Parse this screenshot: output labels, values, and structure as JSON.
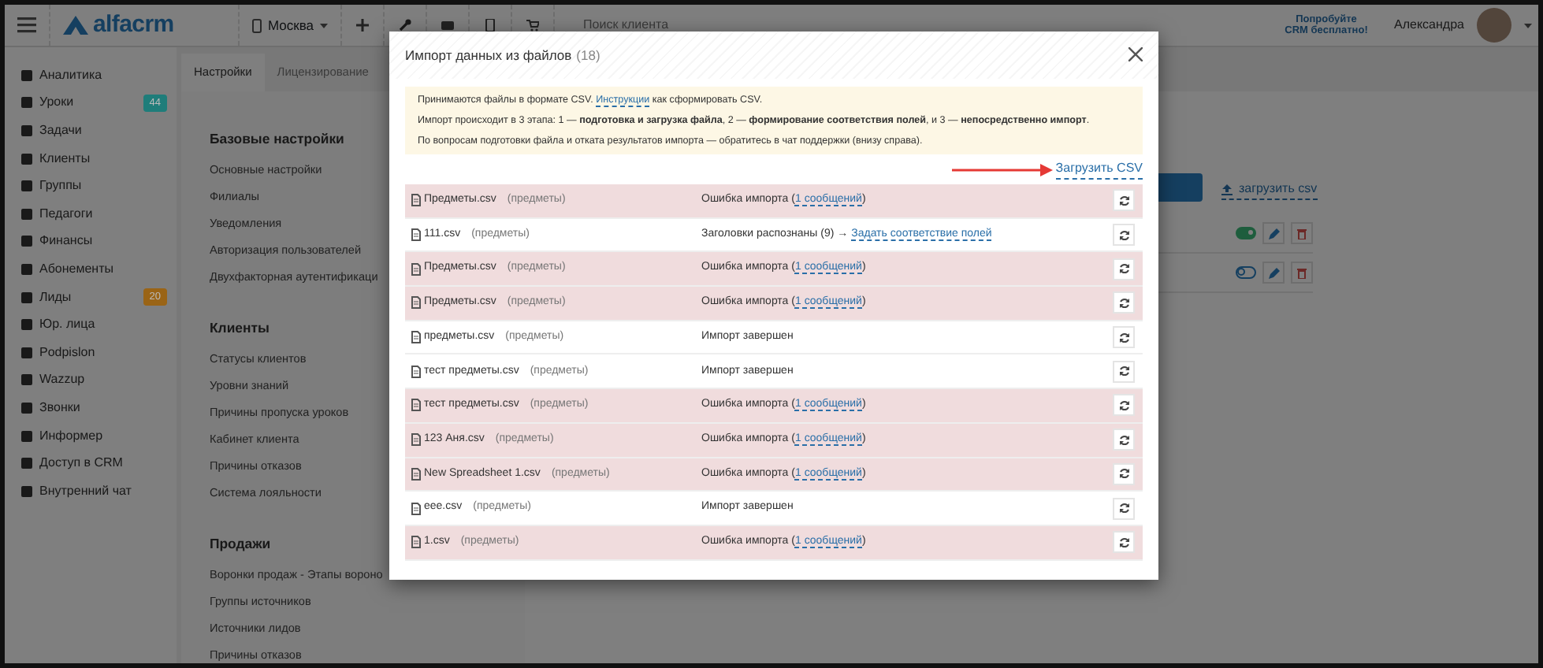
{
  "topbar": {
    "logo": "alfacrm",
    "location": "Москва",
    "search": {
      "placeholder": "Поиск клиента"
    },
    "promo": "Попробуйте CRM бесплатно!",
    "user": "Александра"
  },
  "sidebar": {
    "items": [
      {
        "label": "Аналитика"
      },
      {
        "label": "Уроки",
        "badge": "44",
        "color": "#1f7d7a"
      },
      {
        "label": "Задачи"
      },
      {
        "label": "Клиенты"
      },
      {
        "label": "Группы"
      },
      {
        "label": "Педагоги"
      },
      {
        "label": "Финансы"
      },
      {
        "label": "Абонементы"
      },
      {
        "label": "Лиды",
        "badge": "20",
        "color": "#9a6416"
      },
      {
        "label": "Юр. лица"
      },
      {
        "label": "Podpislon"
      },
      {
        "label": "Wazzup"
      },
      {
        "label": "Звонки"
      },
      {
        "label": "Информер"
      },
      {
        "label": "Доступ в CRM"
      },
      {
        "label": "Внутренний чат"
      }
    ]
  },
  "settings": {
    "tabs": [
      {
        "label": "Настройки",
        "selected": true
      },
      {
        "label": "Лицензирование",
        "selected": false
      }
    ],
    "sections": [
      {
        "title": "Базовые настройки",
        "links": [
          "Основные настройки",
          "Филиалы",
          "Уведомления",
          "Авторизация пользователей",
          "Двухфакторная аутентификаци"
        ]
      },
      {
        "title": "Клиенты",
        "links": [
          "Статусы клиентов",
          "Уровни знаний",
          "Причины пропуска уроков",
          "Кабинет клиента",
          "Причины отказов",
          "Система лояльности"
        ]
      },
      {
        "title": "Продажи",
        "links": [
          "Воронки продаж - Этапы вороно",
          "Группы источников",
          "Источники лидов",
          "Причины отказов"
        ]
      }
    ]
  },
  "background_list": {
    "upload_link": "загрузить csv",
    "rows": [
      {
        "on": true
      },
      {
        "on": false
      }
    ]
  },
  "modal": {
    "title": "Импорт данных из файлов",
    "count": "(18)",
    "info": {
      "line1_before": "Принимаются файлы в формате CSV.",
      "line1_link": "Инструкции",
      "line1_after": "как сформировать CSV.",
      "line2": "Импорт происходит в 3 этапа: 1 — **подготовка и загрузка файла**, 2 — **формирование соответствия полей**, и 3 — **непосредственно импорт**.",
      "line3": "По вопросам подготовки файла и отката результатов импорта — обратитесь в чат поддержки (внизу справа)."
    },
    "upload_link": "Загрузить CSV",
    "rows": [
      {
        "kind": "error",
        "file": "Предметы.csv",
        "type": "(предметы)",
        "status": "Ошибка импорта (",
        "link": "1 сообщений",
        "status_end": ")"
      },
      {
        "kind": "pending",
        "file": "111.csv",
        "type": "(предметы)",
        "status": "Заголовки распознаны (9) →",
        "link": "Задать соответствие полей"
      },
      {
        "kind": "error",
        "file": "Предметы.csv",
        "type": "(предметы)",
        "status": "Ошибка импорта (",
        "link": "1 сообщений",
        "status_end": ")"
      },
      {
        "kind": "error",
        "file": "Предметы.csv",
        "type": "(предметы)",
        "status": "Ошибка импорта (",
        "link": "1 сообщений",
        "status_end": ")"
      },
      {
        "kind": "done",
        "file": "предметы.csv",
        "type": "(предметы)",
        "status": "Импорт завершен"
      },
      {
        "kind": "done",
        "file": "тест предметы.csv",
        "type": "(предметы)",
        "status": "Импорт завершен"
      },
      {
        "kind": "error",
        "file": "тест предметы.csv",
        "type": "(предметы)",
        "status": "Ошибка импорта (",
        "link": "1 сообщений",
        "status_end": ")"
      },
      {
        "kind": "error",
        "file": "123 Аня.csv",
        "type": "(предметы)",
        "status": "Ошибка импорта (",
        "link": "1 сообщений",
        "status_end": ")"
      },
      {
        "kind": "error",
        "file": "New Spreadsheet 1.csv",
        "type": "(предметы)",
        "status": "Ошибка импорта (",
        "link": "1 сообщений",
        "status_end": ")"
      },
      {
        "kind": "done",
        "file": "еее.csv",
        "type": "(предметы)",
        "status": "Импорт завершен"
      },
      {
        "kind": "error",
        "file": "1.csv",
        "type": "(предметы)",
        "status": "Ошибка импорта (",
        "link": "1 сообщений",
        "status_end": ")"
      }
    ]
  }
}
